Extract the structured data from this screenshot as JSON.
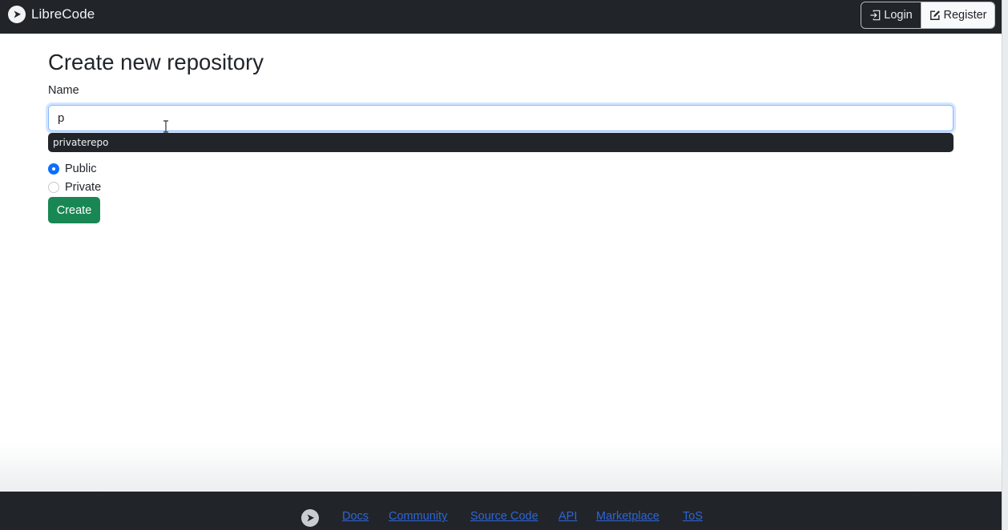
{
  "brand": {
    "name": "LibreCode",
    "logo_icon": "play-circle-icon"
  },
  "nav": {
    "login_label": "Login",
    "register_label": "Register",
    "login_icon": "login-arrow-icon",
    "register_icon": "edit-square-icon"
  },
  "form": {
    "title": "Create new repository",
    "name_label": "Name",
    "name_value": "p",
    "suggestion": "privaterepo",
    "visibility": [
      {
        "label": "Public",
        "checked": true
      },
      {
        "label": "Private",
        "checked": false
      }
    ],
    "submit_label": "Create"
  },
  "footer": {
    "logo_icon": "play-circle-icon",
    "links": [
      "Docs",
      "Community",
      "Source Code",
      "API",
      "Marketplace",
      "ToS"
    ]
  },
  "colors": {
    "navbar_bg": "#212529",
    "primary": "#0d6efd",
    "success": "#198754",
    "link": "#2f64d6"
  }
}
